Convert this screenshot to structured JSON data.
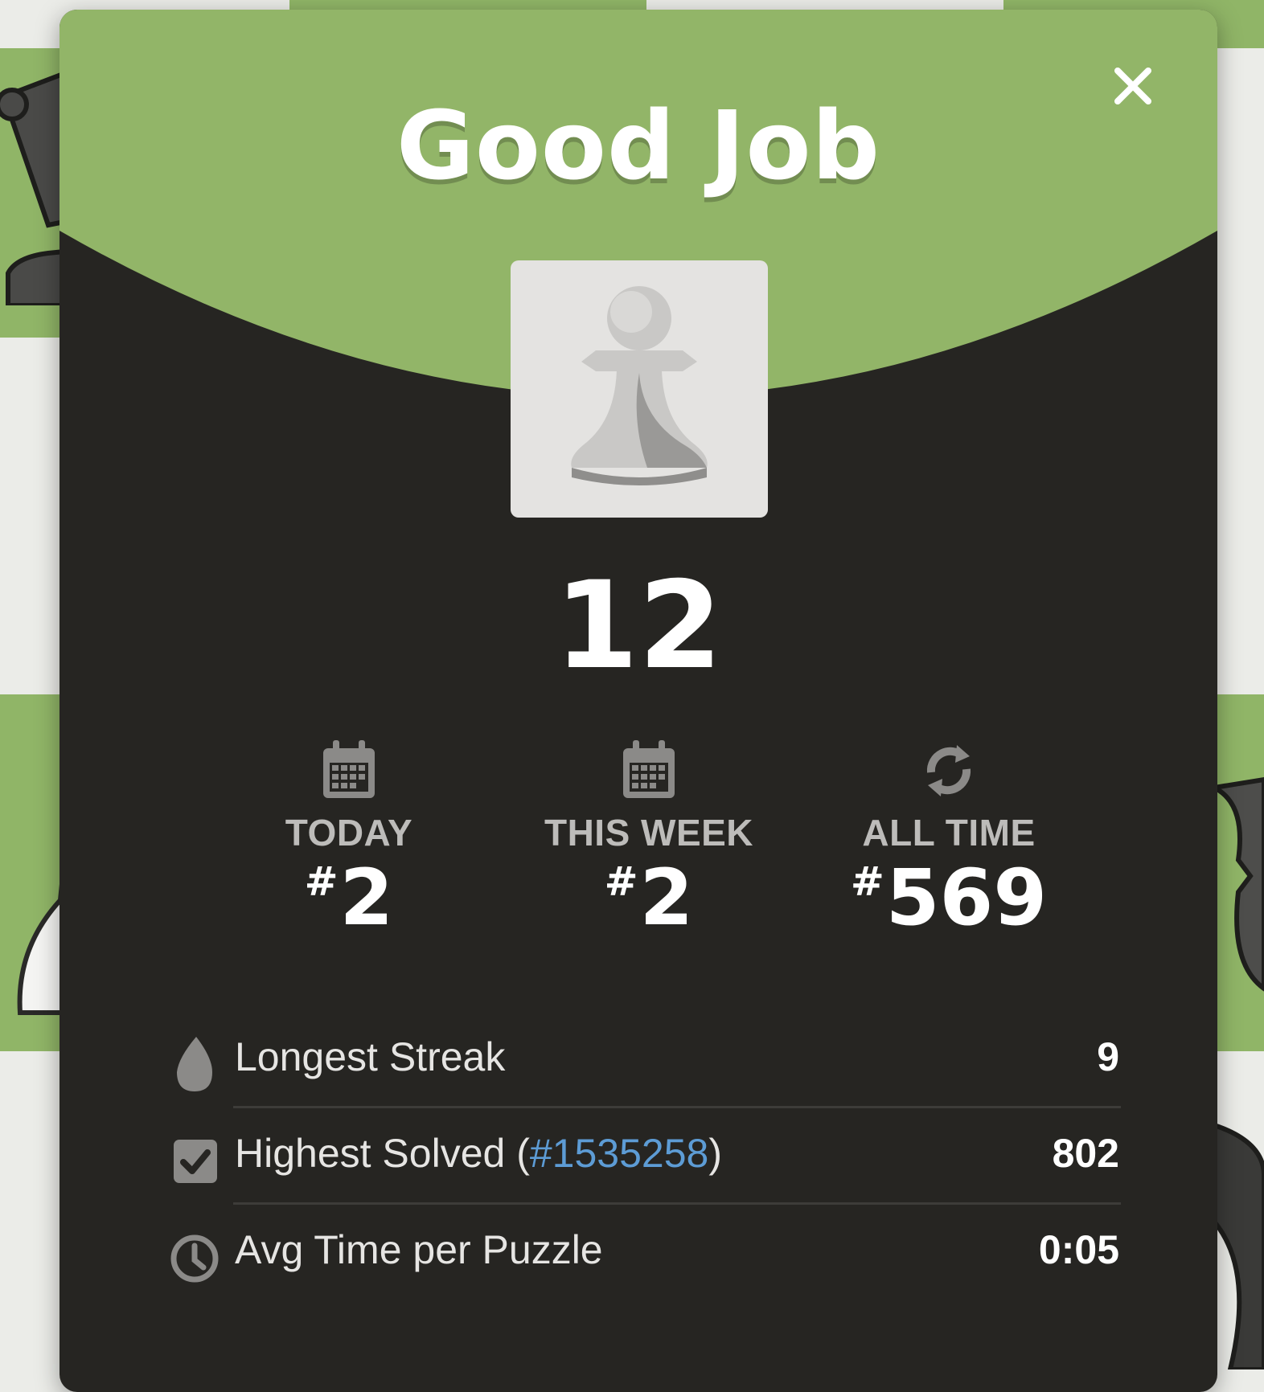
{
  "modal": {
    "title": "Good Job",
    "score": "12"
  },
  "ranks": [
    {
      "label": "TODAY",
      "prefix": "#",
      "value": "2",
      "icon": "calendar-icon"
    },
    {
      "label": "THIS WEEK",
      "prefix": "#",
      "value": "2",
      "icon": "calendar-icon"
    },
    {
      "label": "ALL TIME",
      "prefix": "#",
      "value": "569",
      "icon": "refresh-icon"
    }
  ],
  "stats": {
    "streak": {
      "label": "Longest Streak",
      "value": "9",
      "icon": "flame-icon"
    },
    "highest": {
      "label_prefix": "Highest Solved (",
      "link": "#1535258",
      "label_suffix": ")",
      "value": "802",
      "icon": "checkbox-icon"
    },
    "avg_time": {
      "label": "Avg Time per Puzzle",
      "value": "0:05",
      "icon": "clock-icon"
    }
  },
  "colors": {
    "header_green": "#92b568",
    "panel_dark": "#262522",
    "link_blue": "#5d9cd5"
  }
}
